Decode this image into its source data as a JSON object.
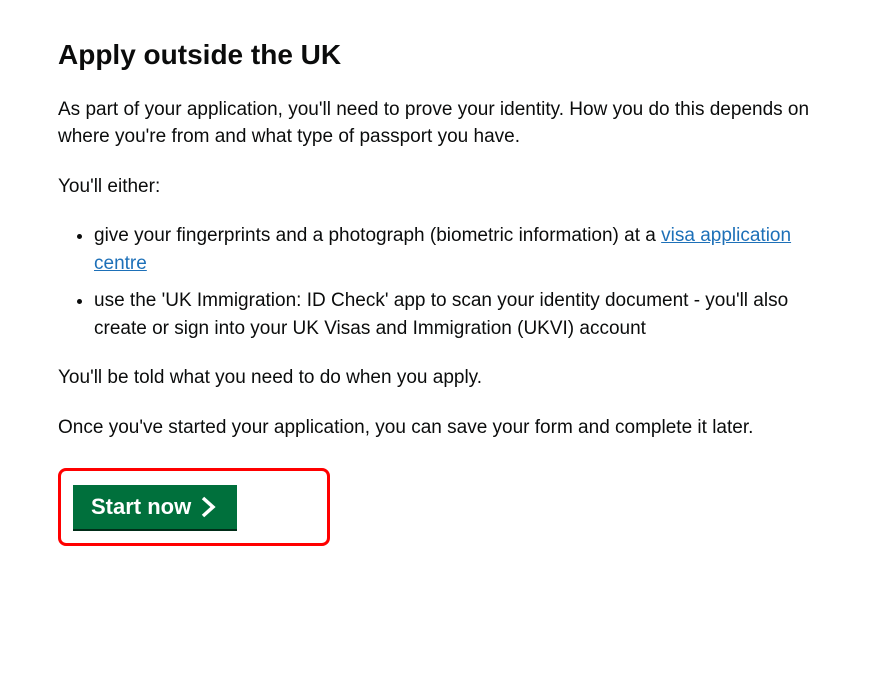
{
  "heading": "Apply outside the UK",
  "intro_paragraph": "As part of your application, you'll need to prove your identity. How you do this depends on where you're from and what type of passport you have.",
  "either_lead": "You'll either:",
  "bullets": {
    "first_prefix": "give your fingerprints and a photograph (biometric information) at a ",
    "first_link": "visa application centre",
    "second": "use the 'UK Immigration: ID Check' app to scan your identity document - you'll also create or sign into your UK Visas and Immigration (UKVI) account"
  },
  "told_paragraph": "You'll be told what you need to do when you apply.",
  "save_paragraph": "Once you've started your application, you can save your form and complete it later.",
  "start_button_label": "Start now"
}
